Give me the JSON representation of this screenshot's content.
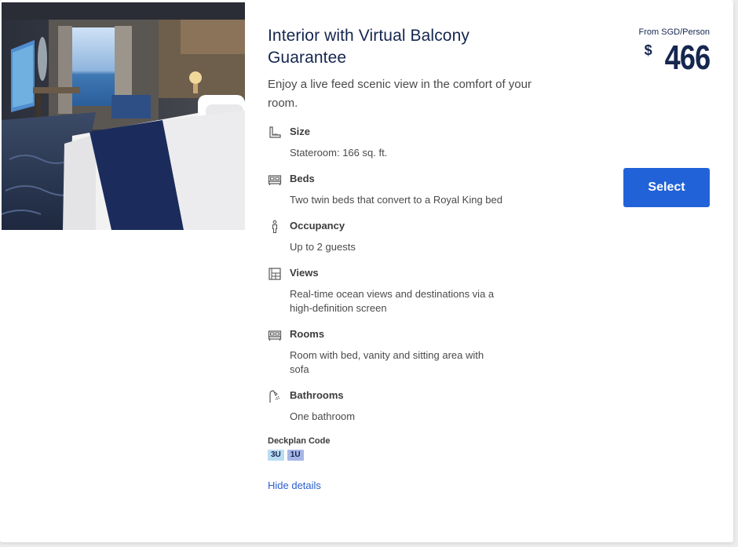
{
  "room": {
    "title": "Interior with Virtual Balcony Guarantee",
    "description": "Enjoy a live feed scenic view in the comfort of your room."
  },
  "features": [
    {
      "name": "Size",
      "value": "Stateroom: 166 sq. ft.",
      "icon": "ruler-icon"
    },
    {
      "name": "Beds",
      "value": "Two twin beds that convert to a Royal King bed",
      "icon": "bed-icon"
    },
    {
      "name": "Occupancy",
      "value": "Up to 2 guests",
      "icon": "person-icon"
    },
    {
      "name": "Views",
      "value": "Real-time ocean views and destinations via a high-definition screen",
      "icon": "window-icon"
    },
    {
      "name": "Rooms",
      "value": "Room with bed, vanity and sitting area with sofa",
      "icon": "bed-icon"
    },
    {
      "name": "Bathrooms",
      "value": "One bathroom",
      "icon": "shower-icon"
    }
  ],
  "deckplan": {
    "label": "Deckplan Code",
    "codes": [
      "3U",
      "1U"
    ]
  },
  "links": {
    "hide_details": "Hide details"
  },
  "pricing": {
    "from_label": "From SGD/Person",
    "currency_symbol": "$",
    "amount": "466"
  },
  "actions": {
    "select_label": "Select"
  },
  "colors": {
    "navy": "#15264f",
    "button_blue": "#2262d8",
    "link_blue": "#2a5ecf",
    "code_1_bg": "#b9dcf2",
    "code_2_bg": "#a7b6e6"
  }
}
